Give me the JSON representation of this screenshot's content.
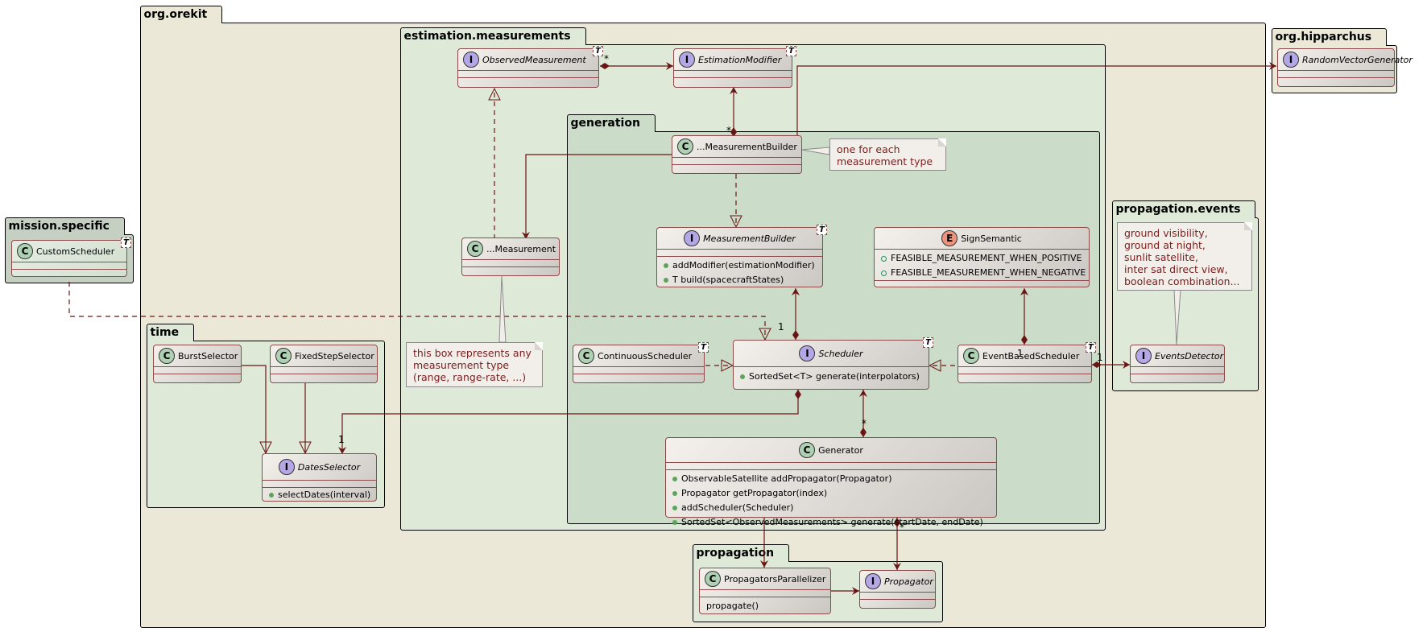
{
  "packages": {
    "org_orekit": "org.orekit",
    "estimation_measurements": "estimation.measurements",
    "generation": "generation",
    "mission_specific": "mission.specific",
    "time": "time",
    "propagation_events": "propagation.events",
    "propagation": "propagation",
    "org_hipparchus": "org.hipparchus"
  },
  "classes": {
    "observed_measurement": {
      "name": "ObservedMeasurement",
      "kind": "I",
      "tparam": "T"
    },
    "estimation_modifier": {
      "name": "EstimationModifier",
      "kind": "I",
      "tparam": "T"
    },
    "measurement_builder_impl": {
      "name": "...MeasurementBuilder",
      "kind": "C"
    },
    "measurement": {
      "name": "...Measurement",
      "kind": "C"
    },
    "measurement_builder": {
      "name": "MeasurementBuilder",
      "kind": "I",
      "tparam": "T",
      "methods": [
        "addModifier(estimationModifier)",
        "T build(spacecraftStates)"
      ]
    },
    "sign_semantic": {
      "name": "SignSemantic",
      "kind": "E",
      "values": [
        "FEASIBLE_MEASUREMENT_WHEN_POSITIVE",
        "FEASIBLE_MEASUREMENT_WHEN_NEGATIVE"
      ]
    },
    "continuous_scheduler": {
      "name": "ContinuousScheduler",
      "kind": "C",
      "tparam": "T"
    },
    "scheduler": {
      "name": "Scheduler",
      "kind": "I",
      "tparam": "T",
      "methods": [
        "SortedSet<T> generate(interpolators)"
      ]
    },
    "event_based_scheduler": {
      "name": "EventBasedScheduler",
      "kind": "C",
      "tparam": "T"
    },
    "generator": {
      "name": "Generator",
      "kind": "C",
      "methods": [
        "ObservableSatellite addPropagator(Propagator)",
        "Propagator getPropagator(index)",
        "addScheduler(Scheduler)",
        "SortedSet<ObservedMeasurements> generate(startDate, endDate)"
      ]
    },
    "custom_scheduler": {
      "name": "CustomScheduler",
      "kind": "C",
      "tparam": "T"
    },
    "burst_selector": {
      "name": "BurstSelector",
      "kind": "C"
    },
    "fixed_step_selector": {
      "name": "FixedStepSelector",
      "kind": "C"
    },
    "dates_selector": {
      "name": "DatesSelector",
      "kind": "I",
      "methods": [
        "selectDates(interval)"
      ]
    },
    "events_detector": {
      "name": "EventsDetector",
      "kind": "I"
    },
    "propagators_parallelizer": {
      "name": "PropagatorsParallelizer",
      "kind": "C",
      "methods": [
        "propagate()"
      ]
    },
    "propagator": {
      "name": "Propagator",
      "kind": "I"
    },
    "random_vector_generator": {
      "name": "RandomVectorGenerator",
      "kind": "I"
    }
  },
  "notes": {
    "builder_note": [
      "one for each",
      "measurement type"
    ],
    "measurement_note": [
      "this box represents any",
      "measurement type",
      "(range, range-rate, ...)"
    ],
    "events_note": [
      "ground visibility,",
      "ground at night,",
      "sunlit satellite,",
      "inter sat direct view,",
      "boolean combination..."
    ]
  },
  "multiplicities": {
    "observed_to_modifier": "*",
    "builder_to_modifier": "*",
    "scheduler_to_builder": "1",
    "event_sched_to_sign": "1",
    "event_sched_to_detector": "1",
    "scheduler_to_dates": "1",
    "generator_to_scheduler": "*",
    "generator_to_propagator": "*"
  },
  "colors": {
    "orekit_bg": "#ebe8d7",
    "package_bg": "#dfe9d8",
    "generation_bg": "#cbdcc8",
    "mission_bg": "#c5d0c3",
    "link": "#6b1414"
  }
}
